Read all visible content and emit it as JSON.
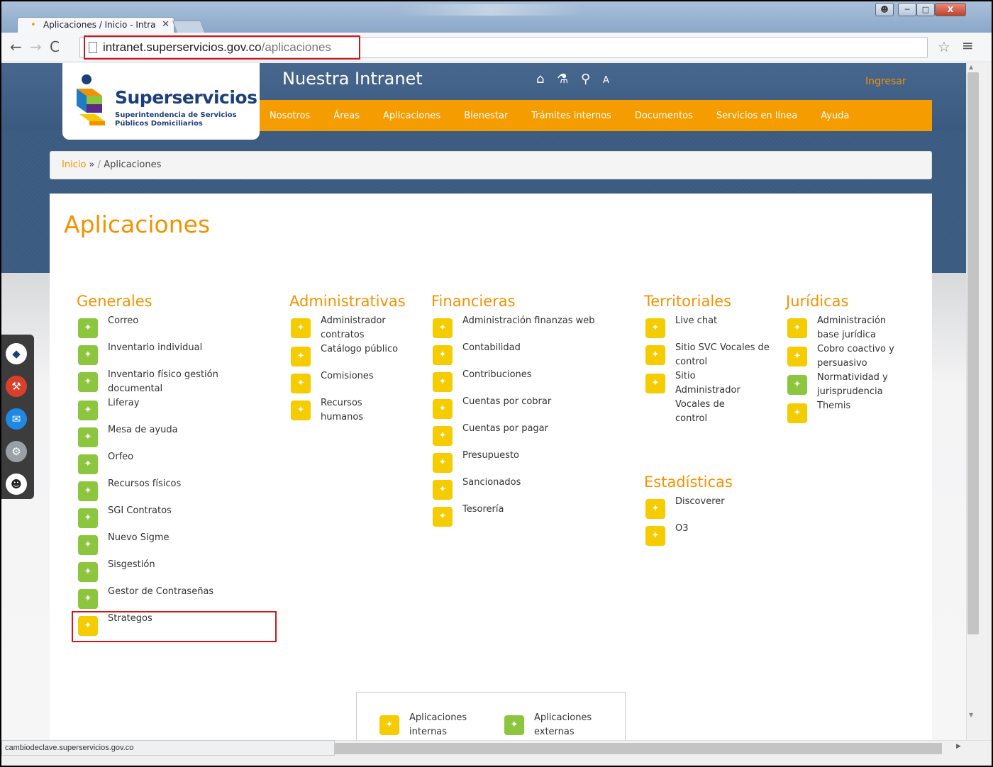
{
  "browser": {
    "tab_title": "Aplicaciones / Inicio - Intra",
    "tab_close": "✕",
    "url_host": "intranet.superservicios.gov.co",
    "url_path": "/aplicaciones",
    "back_icon": "←",
    "forward_icon": "→",
    "reload_icon": "C",
    "bookmark_star_icon": "☆",
    "menu_icon": "≡",
    "status_url": "cambiodeclave.superservicios.gov.co"
  },
  "header": {
    "logo_name": "Superservicios",
    "logo_sub1": "Superintendencia de Servicios",
    "logo_sub2": "Públicos Domiciliarios",
    "site_title": "Nuestra Intranet",
    "font_size_icon_label": "A",
    "login": "Ingresar"
  },
  "nav": {
    "items": [
      "Nosotros",
      "Áreas",
      "Aplicaciones",
      "Bienestar",
      "Trámites internos",
      "Documentos",
      "Servicios en línea",
      "Ayuda"
    ]
  },
  "breadcrumb": {
    "home": "Inicio",
    "arrow": "»",
    "sep": "/",
    "current": "Aplicaciones"
  },
  "page": {
    "title": "Aplicaciones"
  },
  "columns": {
    "generales": {
      "heading": "Generales",
      "items": [
        "Correo",
        "Inventario individual",
        "Inventario físico gestión documental",
        "Liferay",
        "Mesa de ayuda",
        "Orfeo",
        "Recursos físicos",
        "SGI Contratos",
        "Nuevo Sigme",
        "Sisgestión",
        "Gestor de Contraseñas",
        "Strategos"
      ]
    },
    "administrativas": {
      "heading": "Administrativas",
      "items": [
        "Administrador contratos",
        "Catálogo público",
        "Comisiones",
        "Recursos humanos"
      ]
    },
    "financieras": {
      "heading": "Financieras",
      "items": [
        "Administración finanzas web",
        "Contabilidad",
        "Contribuciones",
        "Cuentas por cobrar",
        "Cuentas por pagar",
        "Presupuesto",
        "Sancionados",
        "Tesorería"
      ]
    },
    "territoriales": {
      "heading": "Territoriales",
      "items": [
        "Live chat",
        "Sitio SVC Vocales de control",
        "Sitio Administrador Vocales de control"
      ]
    },
    "estadisticas": {
      "heading": "Estadísticas",
      "items": [
        "Discoverer",
        "O3"
      ]
    },
    "juridicas": {
      "heading": "Jurídicas",
      "items": [
        "Administración base jurídica",
        "Cobro coactivo y persuasivo",
        "Normatividad y jurisprudencia",
        "Themis"
      ]
    }
  },
  "legend": {
    "internal": "Aplicaciones internas",
    "external": "Aplicaciones externas"
  },
  "colors": {
    "accent_orange": "#f39200",
    "nav_orange": "#f59c00",
    "internal_yellow": "#f5cc00",
    "external_green": "#8cc63f",
    "highlight_red": "#d2161e"
  }
}
